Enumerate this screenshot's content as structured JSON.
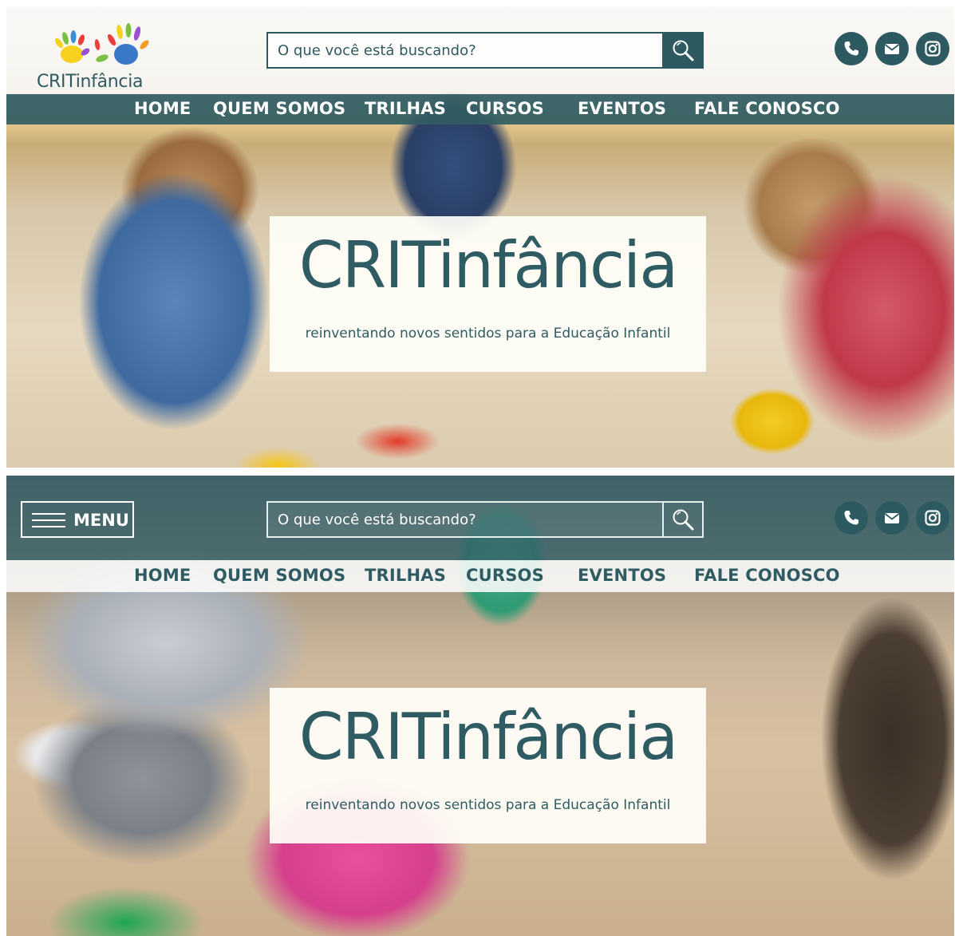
{
  "brand": {
    "logo_text": "CRITinfância",
    "hero_title": "CRITinfância",
    "hero_subtitle": "reinventando novos sentidos para a Educação Infantil",
    "primary_color": "#2d5a61",
    "accent_colors": [
      "#f6d11f",
      "#3a8fd6",
      "#7bc043",
      "#e9403a",
      "#9b4fd1",
      "#f29c2b"
    ]
  },
  "search": {
    "placeholder": "O que você está buscando?",
    "icon": "magnifier-icon"
  },
  "social": [
    {
      "name": "phone",
      "icon": "phone-icon"
    },
    {
      "name": "email",
      "icon": "envelope-icon"
    },
    {
      "name": "instagram",
      "icon": "instagram-icon"
    }
  ],
  "nav": {
    "items": [
      "HOME",
      "QUEM SOMOS",
      "TRILHAS",
      "CURSOS",
      "EVENTOS",
      "FALE CONOSCO"
    ]
  },
  "menu_button": {
    "label": "MENU",
    "icon": "hamburger-icon"
  }
}
